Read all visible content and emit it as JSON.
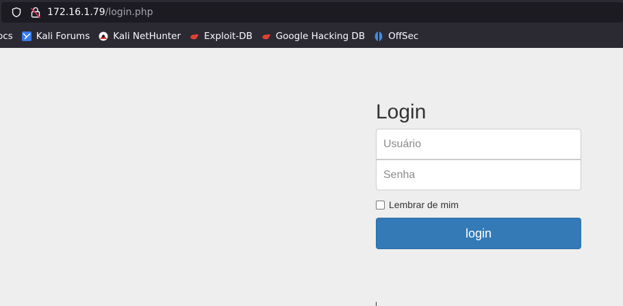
{
  "browser": {
    "url_host": "172.16.1.79",
    "url_path": "/login.php",
    "bookmarks": [
      {
        "label": "ocs",
        "icon": "docs-icon"
      },
      {
        "label": "Kali Forums",
        "icon": "kali-forums-icon"
      },
      {
        "label": "Kali NetHunter",
        "icon": "kali-nethunter-icon"
      },
      {
        "label": "Exploit-DB",
        "icon": "exploit-db-icon"
      },
      {
        "label": "Google Hacking DB",
        "icon": "google-hacking-db-icon"
      },
      {
        "label": "OffSec",
        "icon": "offsec-icon"
      }
    ]
  },
  "login": {
    "title": "Login",
    "username_placeholder": "Usuário",
    "password_placeholder": "Senha",
    "remember_label": "Lembrar de mim",
    "button_label": "login"
  },
  "colors": {
    "chrome_bg": "#2b2a33",
    "page_bg": "#eeeeee",
    "button_bg": "#337ab7"
  }
}
